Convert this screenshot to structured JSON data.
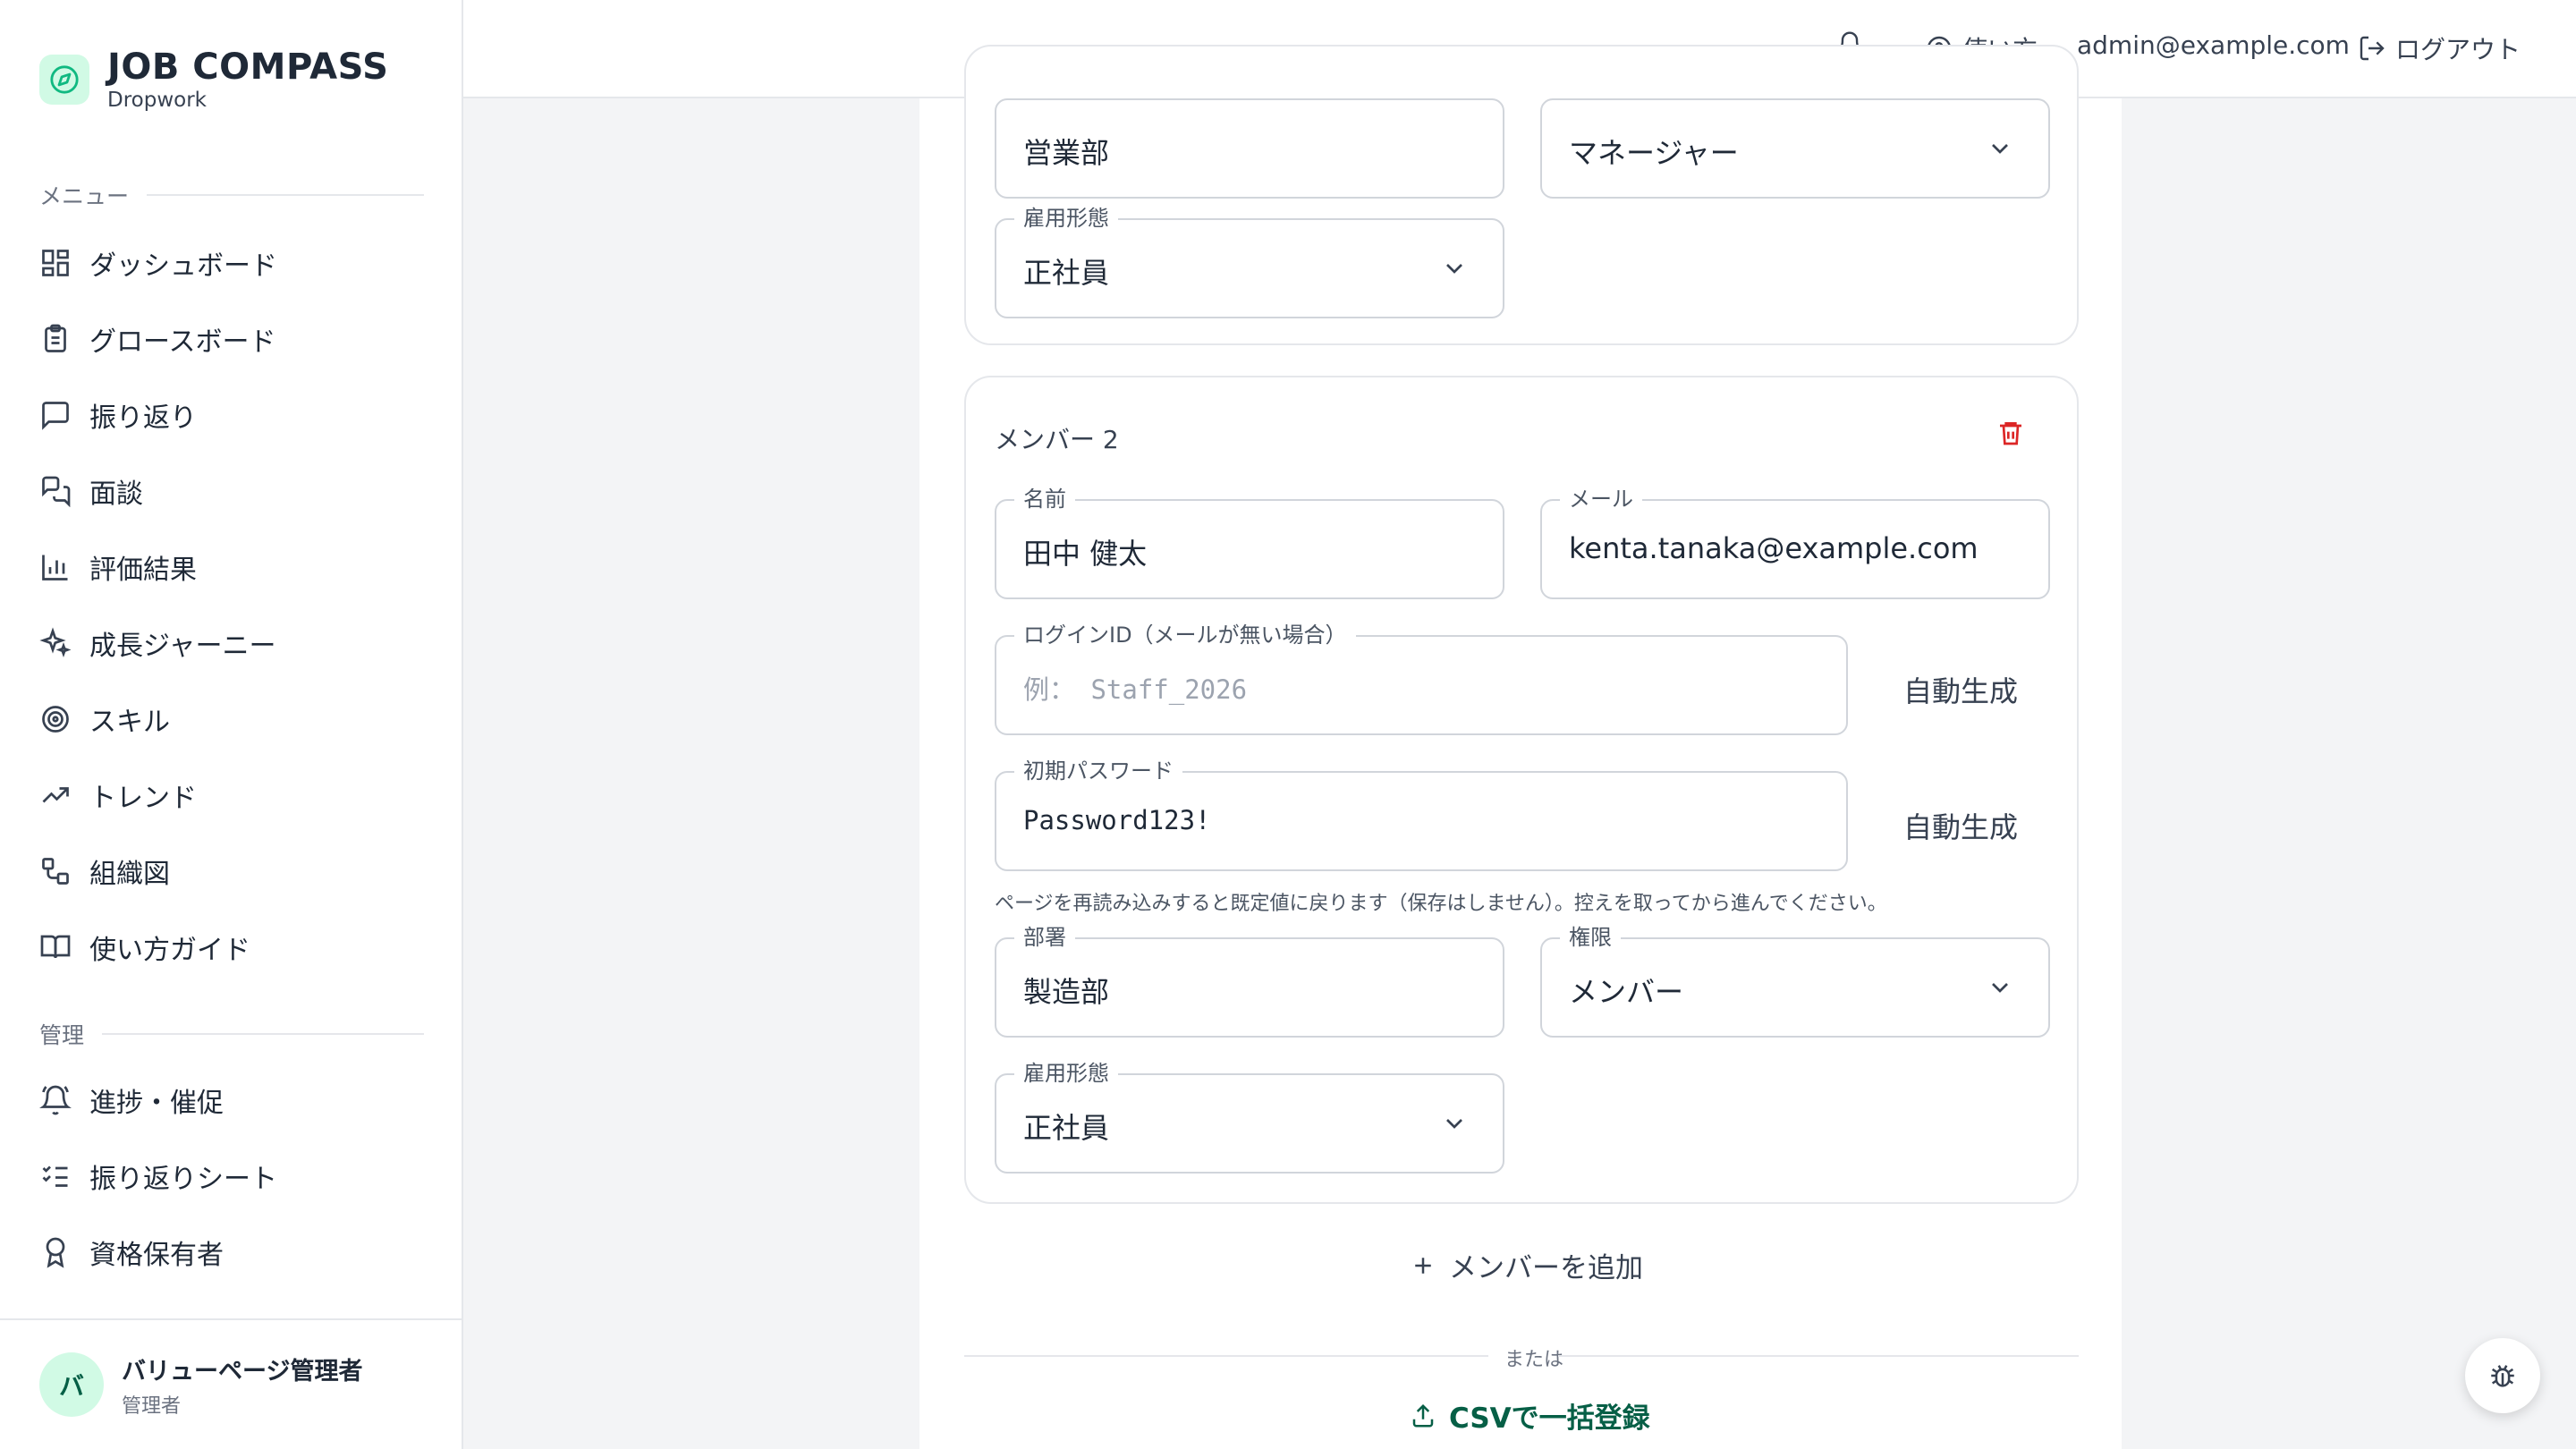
{
  "brand": {
    "title": "JOB COMPASS",
    "subtitle": "Dropwork"
  },
  "sidebar": {
    "menu_label": "メニュー",
    "items": [
      {
        "label": "ダッシュボード",
        "icon": "dashboard-icon"
      },
      {
        "label": "グロースボード",
        "icon": "clipboard-icon"
      },
      {
        "label": "振り返り",
        "icon": "message-square-icon"
      },
      {
        "label": "面談",
        "icon": "messages-icon"
      },
      {
        "label": "評価結果",
        "icon": "bar-chart-icon"
      },
      {
        "label": "成長ジャーニー",
        "icon": "sparkles-icon"
      },
      {
        "label": "スキル",
        "icon": "target-icon"
      },
      {
        "label": "トレンド",
        "icon": "trending-up-icon"
      },
      {
        "label": "組織図",
        "icon": "org-chart-icon"
      },
      {
        "label": "使い方ガイド",
        "icon": "book-icon"
      }
    ],
    "admin_label": "管理",
    "admin_items": [
      {
        "label": "進捗・催促",
        "icon": "bell-ring-icon"
      },
      {
        "label": "振り返りシート",
        "icon": "list-checks-icon"
      },
      {
        "label": "資格保有者",
        "icon": "award-icon"
      }
    ],
    "user": {
      "avatar": "バ",
      "name": "バリューページ管理者",
      "role": "管理者"
    }
  },
  "header": {
    "help_label": "使い方",
    "email": "admin@example.com",
    "logout_label": "ログアウト"
  },
  "member1": {
    "department_value": "営業部",
    "role_value": "マネージャー",
    "employment_label": "雇用形態",
    "employment_value": "正社員"
  },
  "member2": {
    "title": "メンバー 2",
    "name_label": "名前",
    "name_value": "田中 健太",
    "email_label": "メール",
    "email_value": "kenta.tanaka@example.com",
    "login_label": "ログインID（メールが無い場合）",
    "login_placeholder": "例： Staff_2026",
    "auto_gen": "自動生成",
    "password_label": "初期パスワード",
    "password_value": "Password123!",
    "note": "ページを再読み込みすると既定値に戻ります（保存はしません）。控えを取ってから進んでください。",
    "department_label": "部署",
    "department_value": "製造部",
    "role_label": "権限",
    "role_value": "メンバー",
    "employment_label": "雇用形態",
    "employment_value": "正社員"
  },
  "actions": {
    "add_member": "メンバーを追加",
    "or": "または",
    "csv": "CSVで一括登録"
  },
  "colors": {
    "accent": "#065f46",
    "accent_bg": "#d1fae5",
    "danger": "#dc2626"
  }
}
